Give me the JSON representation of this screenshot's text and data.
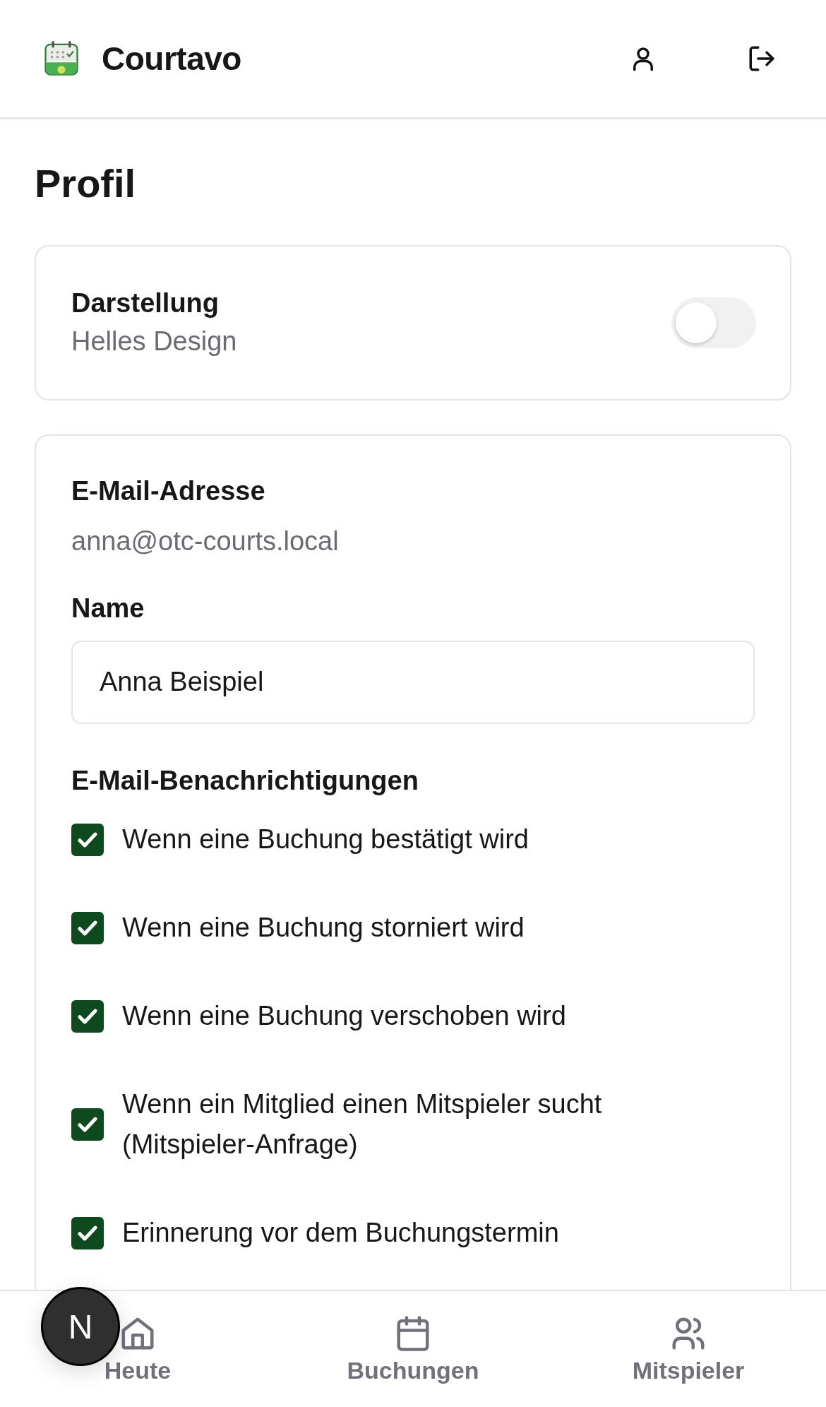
{
  "header": {
    "brand": "Courtavo"
  },
  "page_title": "Profil",
  "appearance": {
    "label": "Darstellung",
    "value": "Helles Design",
    "on": false
  },
  "account": {
    "email_label": "E-Mail-Adresse",
    "email": "anna@otc-courts.local",
    "name_label": "Name",
    "name_value": "Anna Beispiel"
  },
  "notifications": {
    "title": "E-Mail-Benachrichtigungen",
    "options": [
      {
        "label": "Wenn eine Buchung bestätigt wird",
        "checked": true
      },
      {
        "label": "Wenn eine Buchung storniert wird",
        "checked": true
      },
      {
        "label": "Wenn eine Buchung verschoben wird",
        "checked": true
      },
      {
        "label": "Wenn ein Mitglied einen Mitspieler sucht (Mitspieler-Anfrage)",
        "checked": true
      },
      {
        "label": "Erinnerung vor dem Buchungstermin",
        "checked": true
      }
    ]
  },
  "bottom_nav": [
    {
      "label": "Heute",
      "kind": "home",
      "selected": false
    },
    {
      "label": "Buchungen",
      "kind": "calendar",
      "selected": false
    },
    {
      "label": "Mitspieler",
      "kind": "people",
      "selected": false
    }
  ],
  "dev_badge": "N"
}
